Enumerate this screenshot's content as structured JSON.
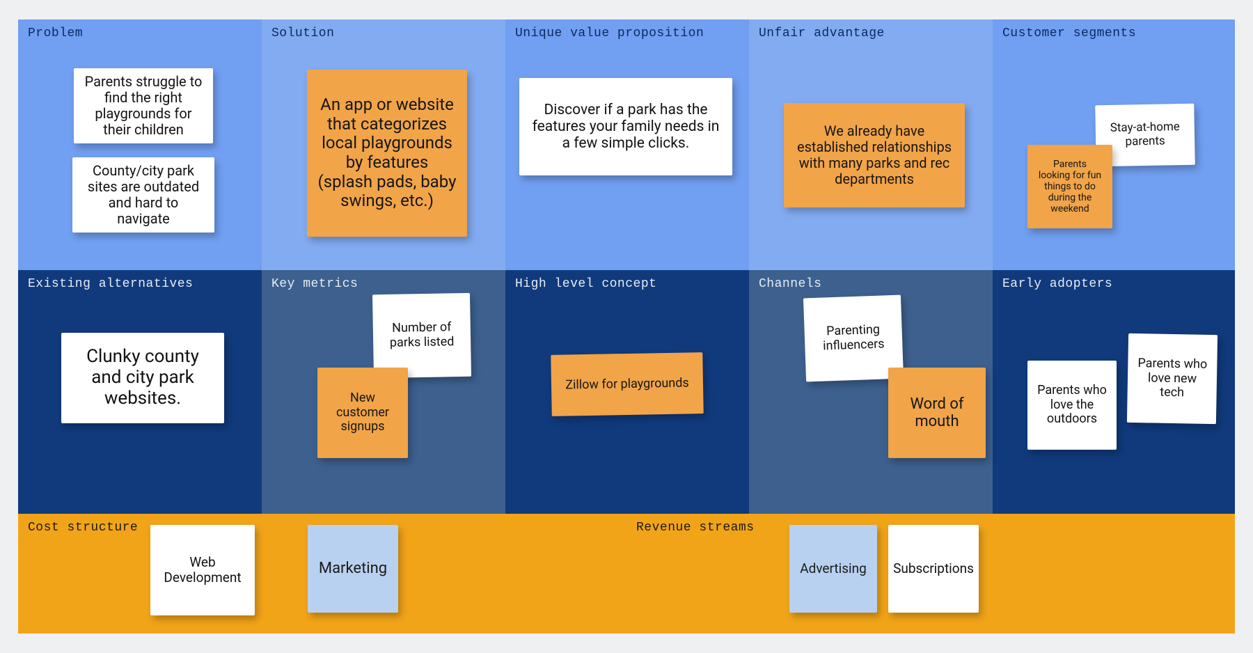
{
  "sections": {
    "problem": {
      "title": "Problem"
    },
    "solution": {
      "title": "Solution"
    },
    "uvp": {
      "title": "Unique value proposition"
    },
    "advantage": {
      "title": "Unfair advantage"
    },
    "segments": {
      "title": "Customer segments"
    },
    "alternatives": {
      "title": "Existing alternatives"
    },
    "metrics": {
      "title": "Key metrics"
    },
    "concept": {
      "title": "High level concept"
    },
    "channels": {
      "title": "Channels"
    },
    "adopters": {
      "title": "Early adopters"
    },
    "cost": {
      "title": "Cost structure"
    },
    "revenue": {
      "title": "Revenue streams"
    }
  },
  "notes": {
    "problem1": "Parents struggle to find the right playgrounds for their children",
    "problem2": "County/city park sites are outdated and hard to navigate",
    "solution1": "An app or website that categorizes local playgrounds by features (splash pads, baby swings, etc.)",
    "uvp1": "Discover if a park has the features your family needs in a few simple clicks.",
    "advantage1": "We already have established relationships with many parks and rec departments",
    "segments1": "Stay-at-home parents",
    "segments2": "Parents looking for fun things to do during the weekend",
    "alt1": "Clunky county and city park websites.",
    "metrics1": "Number of parks listed",
    "metrics2": "New customer signups",
    "concept1": "Zillow for playgrounds",
    "channels1": "Parenting influencers",
    "channels2": "Word of mouth",
    "adopters1": "Parents who love the outdoors",
    "adopters2": "Parents who love new tech",
    "cost1": "Web Development",
    "cost2": "Marketing",
    "revenue1": "Advertising",
    "revenue2": "Subscriptions"
  }
}
